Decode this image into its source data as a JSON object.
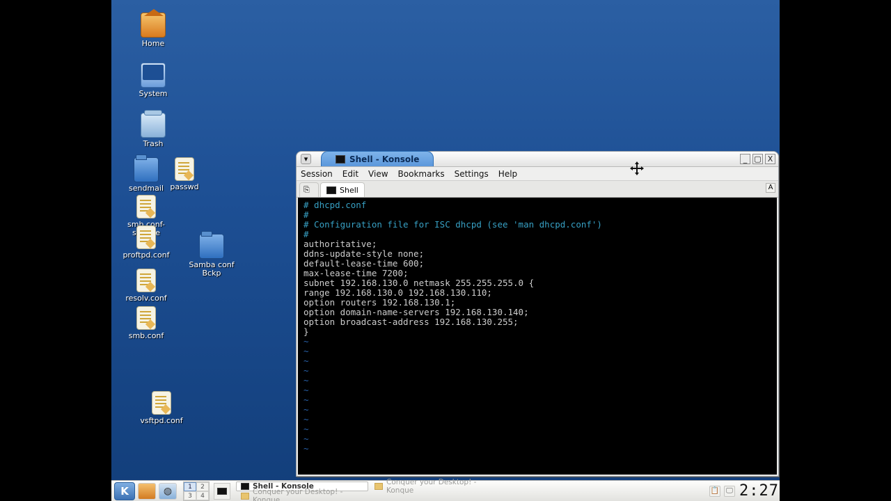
{
  "desktop_icons": {
    "home": "Home",
    "system": "System",
    "trash": "Trash",
    "sendmail": "sendmail",
    "passwd": "passwd",
    "smbsample": "smb.conf-sample",
    "proftpd": "proftpd.conf",
    "samba_bckp": "Samba conf Bckp",
    "resolv": "resolv.conf",
    "smb": "smb.conf",
    "vsftpd": "vsftpd.conf"
  },
  "window": {
    "title": "Shell - Konsole",
    "menu": [
      "Session",
      "Edit",
      "View",
      "Bookmarks",
      "Settings",
      "Help"
    ],
    "tab": "Shell",
    "buttons": {
      "min": "_",
      "max": "▢",
      "close": "X",
      "sys": "▾"
    }
  },
  "terminal": {
    "l1": "# dhcpd.conf",
    "l2": "#",
    "l3": "# Configuration file for ISC dhcpd (see 'man dhcpd.conf')",
    "l4": "#",
    "l5": "authoritative;",
    "l6": "ddns-update-style none;",
    "l7": "default-lease-time 600;",
    "l8": "max-lease-time 7200;",
    "l9": "",
    "l10": "subnet 192.168.130.0 netmask 255.255.255.0 {",
    "l11": "    range 192.168.130.0 192.168.130.110;",
    "l12": "    option routers 192.168.130.1;",
    "l13": "    option domain-name-servers 192.168.130.140;",
    "l14": "    option broadcast-address 192.168.130.255;",
    "l15": "}",
    "tilde": "~"
  },
  "taskbar": {
    "kmenu": "K",
    "desktops": [
      "1",
      "2",
      "3",
      "4"
    ],
    "entries": [
      {
        "label": "Shell - Konsole",
        "active": true
      },
      {
        "label": "Conquer your Desktop! - Konque",
        "active": false
      },
      {
        "label": "Conquer your Desktop! - Konque",
        "active": false
      }
    ],
    "clock": "2:27"
  }
}
